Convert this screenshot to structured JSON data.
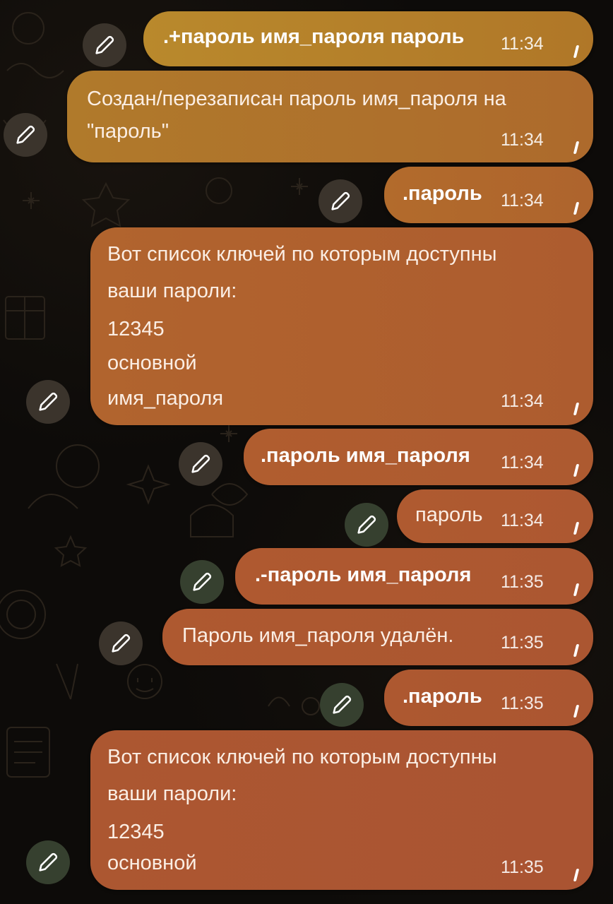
{
  "messages": [
    {
      "text": ".+пароль имя_пароля пароль",
      "time": "11:34"
    },
    {
      "lines": [
        "Создан/перезаписан пароль имя_пароля на",
        "\"пароль\""
      ],
      "time": "11:34"
    },
    {
      "text": ".пароль",
      "time": "11:34"
    },
    {
      "lines": [
        "Вот список ключей по которым доступны",
        "ваши пароли:",
        "12345",
        "основной",
        "имя_пароля"
      ],
      "time": "11:34"
    },
    {
      "text": ".пароль имя_пароля",
      "time": "11:34"
    },
    {
      "text": "пароль",
      "time": "11:34"
    },
    {
      "text": ".-пароль имя_пароля",
      "time": "11:35"
    },
    {
      "text": "Пароль имя_пароля удалён.",
      "time": "11:35"
    },
    {
      "text": ".пароль",
      "time": "11:35"
    },
    {
      "lines": [
        "Вот список ключей по которым доступны",
        "ваши пароли:",
        "12345",
        "основной"
      ],
      "time": "11:35"
    }
  ],
  "icons": {
    "edit": "pencil-icon",
    "read_mark": "sent-tick-icon"
  },
  "colors": {
    "background": "#0d0b09",
    "bubble_gold": "#b88a2e",
    "bubble_orange": "#b05a30",
    "edit_button": "#3b342c",
    "edit_button_green": "#36402f"
  }
}
